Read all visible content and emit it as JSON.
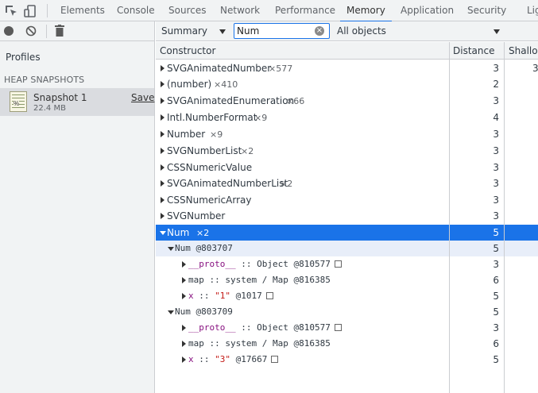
{
  "tabs": [
    "Elements",
    "Console",
    "Sources",
    "Network",
    "Performance",
    "Memory",
    "Application",
    "Security",
    "Lig"
  ],
  "active_tab": "Memory",
  "left_panel": {
    "profiles_label": "Profiles",
    "heap_snapshots_label": "HEAP SNAPSHOTS",
    "snapshot": {
      "name": "Snapshot 1",
      "size": "22.4 MB",
      "save_label": "Save",
      "icon_text": "%"
    }
  },
  "toolbar": {
    "view_select": "Summary",
    "filter_value": "Num",
    "objects_select": "All objects"
  },
  "columns": {
    "constructor": "Constructor",
    "distance": "Distance",
    "shallow": "Shallow"
  },
  "rows": [
    {
      "name": "SVGAnimatedNumber",
      "count": "×577",
      "distance": "3",
      "shallow": "3"
    },
    {
      "name": "(number)",
      "count": "×410",
      "distance": "2",
      "shallow": ""
    },
    {
      "name": "SVGAnimatedEnumeration",
      "count": "×66",
      "distance": "3",
      "shallow": ""
    },
    {
      "name": "Intl.NumberFormat",
      "count": "×9",
      "distance": "4",
      "shallow": ""
    },
    {
      "name": "Number",
      "count": "×9",
      "distance": "3",
      "shallow": ""
    },
    {
      "name": "SVGNumberList",
      "count": "×2",
      "distance": "3",
      "shallow": ""
    },
    {
      "name": "CSSNumericValue",
      "count": "",
      "distance": "3",
      "shallow": ""
    },
    {
      "name": "SVGAnimatedNumberList",
      "count": "×2",
      "distance": "3",
      "shallow": ""
    },
    {
      "name": "CSSNumericArray",
      "count": "",
      "distance": "3",
      "shallow": ""
    },
    {
      "name": "SVGNumber",
      "count": "",
      "distance": "3",
      "shallow": ""
    }
  ],
  "selected_row": {
    "name": "Num",
    "count": "×2",
    "distance": "5"
  },
  "instances": [
    {
      "label": "Num @803707",
      "distance": "5",
      "children": [
        {
          "key": "__proto__",
          "sep": " :: ",
          "value": "Object @810577",
          "distance": "3"
        },
        {
          "key": "map",
          "sep": " :: ",
          "value": "system / Map @816385",
          "distance": "6"
        },
        {
          "key": "x",
          "sep": " :: ",
          "value": "\"1\"",
          "extra": " @1017",
          "distance": "5"
        }
      ]
    },
    {
      "label": "Num @803709",
      "distance": "5",
      "children": [
        {
          "key": "__proto__",
          "sep": " :: ",
          "value": "Object @810577",
          "distance": "3"
        },
        {
          "key": "map",
          "sep": " :: ",
          "value": "system / Map @816385",
          "distance": "6"
        },
        {
          "key": "x",
          "sep": " :: ",
          "value": "\"3\"",
          "extra": " @17667",
          "distance": "5"
        }
      ]
    }
  ],
  "colors": {
    "accent": "#1a73e8",
    "selected_bg": "#1a73e8",
    "sub_bg": "#e8eef9",
    "panel_bg": "#f1f3f4"
  }
}
